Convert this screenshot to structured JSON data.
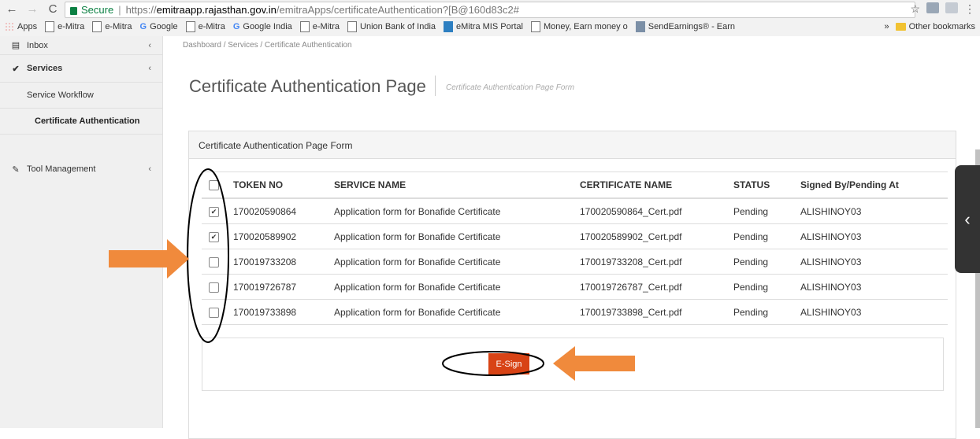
{
  "browser": {
    "nav": {
      "back": "←",
      "forward": "→",
      "reload": "C"
    },
    "secure_label": "Secure",
    "url_scheme": "https://",
    "url_host": "emitraapp.rajasthan.gov.in",
    "url_path": "/emitraApps/certificateAuthentication?[B@160d83c2#",
    "star": "☆",
    "menu": "⋮",
    "bookmarks": [
      {
        "label": "Apps",
        "icon": "apps-icon"
      },
      {
        "label": "e-Mitra",
        "icon": "page-icon"
      },
      {
        "label": "e-Mitra",
        "icon": "page-icon"
      },
      {
        "label": "Google",
        "icon": "google-icon"
      },
      {
        "label": "e-Mitra",
        "icon": "page-icon"
      },
      {
        "label": "Google India",
        "icon": "google-icon"
      },
      {
        "label": "e-Mitra",
        "icon": "page-icon"
      },
      {
        "label": "Union Bank of India",
        "icon": "page-icon"
      },
      {
        "label": "eMitra MIS Portal",
        "icon": "portal-icon"
      },
      {
        "label": "Money, Earn money o",
        "icon": "page-icon"
      },
      {
        "label": "SendEarnings® - Earn",
        "icon": "mail-icon"
      }
    ],
    "more_bookmarks": "»",
    "other_bookmarks": "Other bookmarks"
  },
  "sidebar": {
    "inbox": "Inbox",
    "services": "Services",
    "service_workflow": "Service Workflow",
    "certificate_authentication": "Certificate Authentication",
    "tool_management": "Tool Management"
  },
  "breadcrumb": "Dashboard / Services / Certificate Authentication",
  "page": {
    "title": "Certificate Authentication Page",
    "subtitle": "Certificate Authentication Page Form",
    "panel_title": "Certificate Authentication Page Form"
  },
  "table": {
    "headers": {
      "token": "TOKEN NO",
      "service": "SERVICE NAME",
      "certificate": "CERTIFICATE NAME",
      "status": "STATUS",
      "signed": "Signed By/Pending At"
    },
    "rows": [
      {
        "checked": true,
        "token": "170020590864",
        "service": "Application form for Bonafide Certificate",
        "certificate": "170020590864_Cert.pdf",
        "status": "Pending",
        "signed": "ALISHINOY03"
      },
      {
        "checked": true,
        "token": "170020589902",
        "service": "Application form for Bonafide Certificate",
        "certificate": "170020589902_Cert.pdf",
        "status": "Pending",
        "signed": "ALISHINOY03"
      },
      {
        "checked": false,
        "token": "170019733208",
        "service": "Application form for Bonafide Certificate",
        "certificate": "170019733208_Cert.pdf",
        "status": "Pending",
        "signed": "ALISHINOY03"
      },
      {
        "checked": false,
        "token": "170019726787",
        "service": "Application form for Bonafide Certificate",
        "certificate": "170019726787_Cert.pdf",
        "status": "Pending",
        "signed": "ALISHINOY03"
      },
      {
        "checked": false,
        "token": "170019733898",
        "service": "Application form for Bonafide Certificate",
        "certificate": "170019733898_Cert.pdf",
        "status": "Pending",
        "signed": "ALISHINOY03"
      }
    ]
  },
  "esign_label": "E-Sign",
  "right_tab_icon": "‹",
  "colors": {
    "esign": "#d84315",
    "arrow": "#f08a3c",
    "secure": "#0b8043"
  }
}
